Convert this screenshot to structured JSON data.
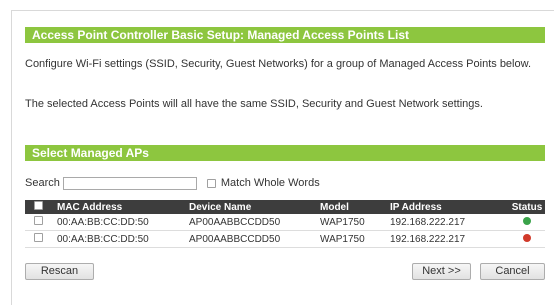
{
  "page_title": "Access Point Controller Basic Setup: Managed Access Points List",
  "intro_line1": "Configure Wi-Fi settings (SSID, Security, Guest Networks) for a group of Managed Access Points below.",
  "intro_line2": "The selected Access Points will all have the same SSID, Security and Guest Network settings.",
  "section_title": "Select Managed APs",
  "search": {
    "label": "Search",
    "value": "",
    "placeholder": ""
  },
  "match_whole_words": {
    "label": "Match Whole Words",
    "checked": false
  },
  "table": {
    "headers": {
      "mac": "MAC Address",
      "device": "Device Name",
      "model": "Model",
      "ip": "IP Address",
      "status": "Status"
    },
    "rows": [
      {
        "mac": "00:AA:BB:CC:DD:50",
        "device": "AP00AABBCCDD50",
        "model": "WAP1750",
        "ip": "192.168.222.217",
        "status": "online",
        "status_color": "#3aa34a"
      },
      {
        "mac": "00:AA:BB:CC:DD:50",
        "device": "AP00AABBCCDD50",
        "model": "WAP1750",
        "ip": "192.168.222.217",
        "status": "offline",
        "status_color": "#d13a2a"
      }
    ]
  },
  "buttons": {
    "rescan": "Rescan",
    "next": "Next >>",
    "cancel": "Cancel"
  },
  "colors": {
    "accent_green": "#8dc63f",
    "table_header": "#3d3d3d"
  }
}
